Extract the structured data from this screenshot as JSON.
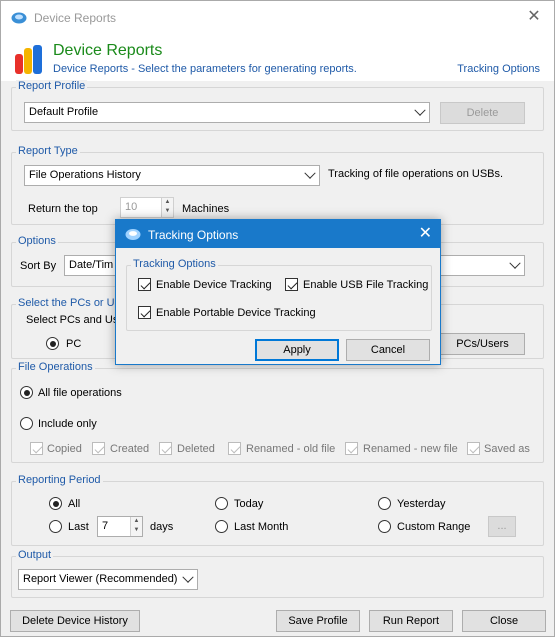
{
  "window": {
    "title": "Device Reports",
    "close_glyph": "✕"
  },
  "header": {
    "title": "Device Reports",
    "subtitle": "Device Reports - Select the parameters for generating reports.",
    "tracking_link": "Tracking Options"
  },
  "report_profile": {
    "label": "Report Profile",
    "selected": "Default Profile",
    "delete_label": "Delete"
  },
  "report_type": {
    "label": "Report Type",
    "selected": "File Operations History",
    "description": "Tracking of file operations on USBs.",
    "return_top_label": "Return the top",
    "top_value": "10",
    "machines_label": "Machines"
  },
  "options": {
    "label": "Options",
    "sort_by_label": "Sort By",
    "sort_by_value": "Date/Tim"
  },
  "pcs": {
    "label": "Select the PCs or Us",
    "prompt": "Select PCs and Use",
    "pc_label": "PC",
    "pcs_users_button": "PCs/Users"
  },
  "file_operations": {
    "label": "File Operations",
    "all_label": "All file operations",
    "include_only_label": "Include only",
    "items": [
      "Copied",
      "Created",
      "Deleted",
      "Renamed - old file",
      "Renamed - new file",
      "Saved as"
    ]
  },
  "reporting_period": {
    "label": "Reporting Period",
    "all": "All",
    "today": "Today",
    "yesterday": "Yesterday",
    "last": "Last",
    "last_value": "7",
    "days": "days",
    "last_month": "Last Month",
    "custom_range": "Custom Range",
    "custom_button": "..."
  },
  "output": {
    "label": "Output",
    "selected": "Report Viewer (Recommended)"
  },
  "footer": {
    "delete_history": "Delete Device History",
    "save_profile": "Save Profile",
    "run_report": "Run Report",
    "close": "Close"
  },
  "dialog": {
    "title": "Tracking Options",
    "close_glyph": "✕",
    "group_label": "Tracking Options",
    "enable_device": "Enable Device Tracking",
    "enable_usb": "Enable USB File Tracking",
    "enable_portable": "Enable Portable Device Tracking",
    "apply": "Apply",
    "cancel": "Cancel"
  },
  "colors": {
    "accent": "#1979ca",
    "title_green": "#1a8a1a",
    "link_blue": "#1f5aa8"
  }
}
